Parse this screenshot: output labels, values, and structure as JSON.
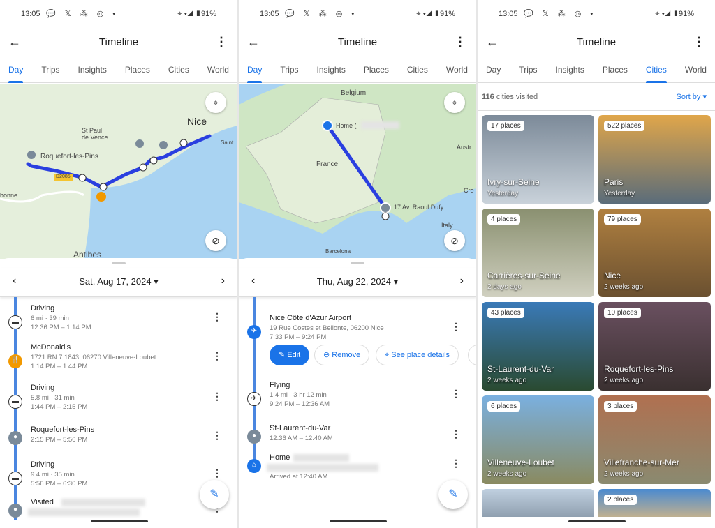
{
  "status": {
    "time": "13:05",
    "battery": "91%",
    "icons": [
      "message-icon",
      "x-icon",
      "fan-icon",
      "instagram-icon",
      "dot-icon"
    ]
  },
  "header": {
    "title": "Timeline"
  },
  "tabs": [
    "Day",
    "Trips",
    "Insights",
    "Places",
    "Cities",
    "World"
  ],
  "colors": {
    "accent": "#1a73e8",
    "route": "#2a3fe0",
    "land": "#e5efdc",
    "water": "#a9d3f2",
    "food": "#f29900"
  },
  "panel1": {
    "active_tab": "Day",
    "map_labels": {
      "nice": "Nice",
      "st_paul": "St Paul\nde Vence",
      "roquefort": "Roquefort-les-Pins",
      "road": "D2085",
      "saint": "Saint",
      "antibes": "Antibes",
      "bonne": "bonne"
    },
    "date": "Sat, Aug 17, 2024",
    "items": [
      {
        "title": "Driving",
        "line1": "6 mi · 39 min",
        "line2": "12:36 PM – 1:14 PM",
        "icon": "car-icon"
      },
      {
        "title": "McDonald's",
        "line1": "1721 RN 7 1843, 06270 Villeneuve-Loubet",
        "line2": "1:14 PM – 1:44 PM",
        "icon": "restaurant-icon"
      },
      {
        "title": "Driving",
        "line1": "5.8 mi · 31 min",
        "line2": "1:44 PM – 2:15 PM",
        "icon": "car-icon"
      },
      {
        "title": "Roquefort-les-Pins",
        "line1": "2:15 PM – 5:56 PM",
        "icon": "place-icon"
      },
      {
        "title": "Driving",
        "line1": "9.4 mi · 35 min",
        "line2": "5:56 PM – 6:30 PM",
        "icon": "car-icon"
      },
      {
        "title": "Visited",
        "icon": "place-icon"
      }
    ]
  },
  "panel2": {
    "active_tab": "Day",
    "map_labels": {
      "belgium": "Belgium",
      "france": "France",
      "austria": "Austr",
      "home": "Home (",
      "address": "17 Av. Raoul Dufy",
      "croatia": "Cro",
      "italy": "Italy",
      "barcelona": "Barcelona"
    },
    "date": "Thu, Aug 22, 2024",
    "items": [
      {
        "title": "Nice Côte d'Azur Airport",
        "line1": "19 Rue Costes et Bellonte, 06200 Nice",
        "line2": "7:33 PM – 9:24 PM",
        "icon": "airplane-icon"
      },
      {
        "title": "Flying",
        "line1": "1.4 mi · 3 hr 12 min",
        "line2": "9:24 PM – 12:36 AM",
        "icon": "airplane-icon"
      },
      {
        "title": "St-Laurent-du-Var",
        "line1": "12:36 AM – 12:40 AM",
        "icon": "place-icon"
      },
      {
        "title": "Home",
        "line2": "Arrived at 12:40 AM",
        "icon": "home-icon"
      }
    ],
    "actions": {
      "edit": "Edit",
      "remove": "Remove",
      "details": "See place details"
    }
  },
  "panel3": {
    "active_tab": "Cities",
    "summary_count": "116",
    "summary_text": "cities visited",
    "sort_label": "Sort by",
    "cities": [
      {
        "places": "17 places",
        "name": "Ivry-sur-Seine",
        "when": "Yesterday"
      },
      {
        "places": "522 places",
        "name": "Paris",
        "when": "Yesterday"
      },
      {
        "places": "4 places",
        "name": "Carrières-sur-Seine",
        "when": "2 days ago"
      },
      {
        "places": "79 places",
        "name": "Nice",
        "when": "2 weeks ago"
      },
      {
        "places": "43 places",
        "name": "St-Laurent-du-Var",
        "when": "2 weeks ago"
      },
      {
        "places": "10 places",
        "name": "Roquefort-les-Pins",
        "when": "2 weeks ago"
      },
      {
        "places": "6 places",
        "name": "Villeneuve-Loubet",
        "when": "2 weeks ago"
      },
      {
        "places": "3 places",
        "name": "Villefranche-sur-Mer",
        "when": "2 weeks ago"
      },
      {
        "places": "",
        "name": "",
        "when": ""
      },
      {
        "places": "2 places",
        "name": "",
        "when": ""
      }
    ]
  }
}
